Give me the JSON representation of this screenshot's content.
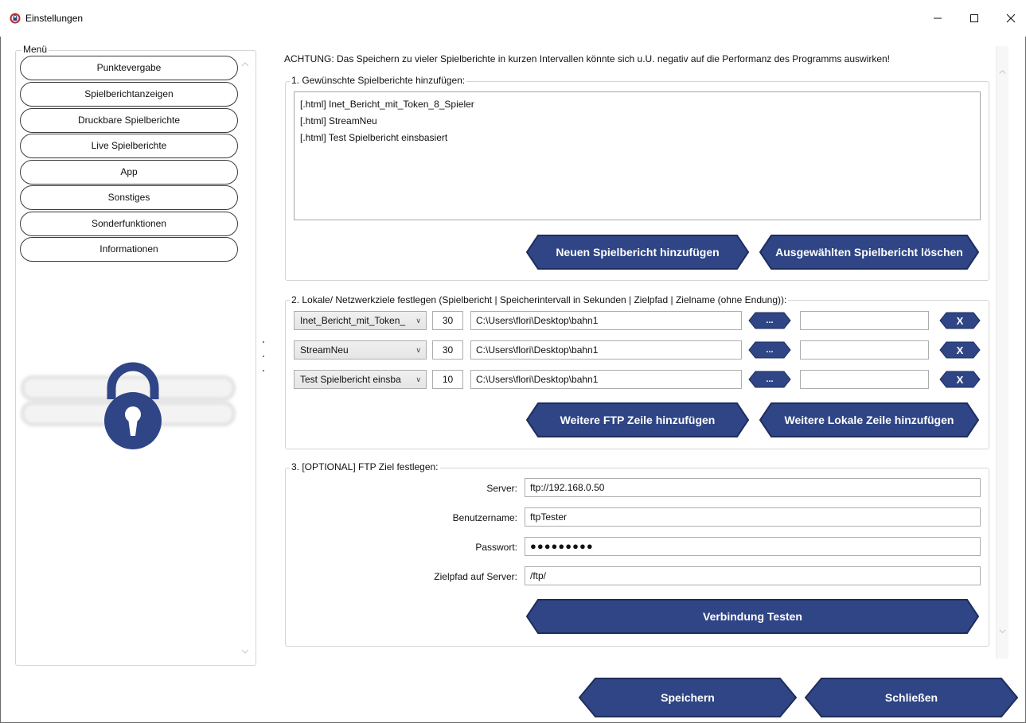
{
  "window": {
    "title": "Einstellungen",
    "app_icon": "lock-shield-icon",
    "controls": {
      "minimize_icon": "minimize-icon",
      "maximize_icon": "maximize-icon",
      "close_icon": "close-icon"
    }
  },
  "menu": {
    "legend": "Menü",
    "items": [
      {
        "label": "Punktevergabe"
      },
      {
        "label": "Spielberichtanzeigen"
      },
      {
        "label": "Druckbare Spielberichte"
      },
      {
        "label": "Live Spielberichte"
      },
      {
        "label": "App"
      },
      {
        "label": "Sonstiges"
      },
      {
        "label": "Sonderfunktionen"
      },
      {
        "label": "Informationen"
      }
    ],
    "locked_icon": "padlock-icon"
  },
  "main": {
    "warning": "ACHTUNG: Das Speichern zu vieler Spielberichte in kurzen Intervallen könnte sich u.U. negativ auf die Performanz des Programms auswirken!",
    "section1": {
      "legend": "1. Gewünschte Spielberichte hinzufügen:",
      "items": [
        "[.html] Inet_Bericht_mit_Token_8_Spieler",
        "[.html] StreamNeu",
        "[.html] Test Spielbericht einsbasiert"
      ],
      "add_button": "Neuen Spielbericht hinzufügen",
      "delete_button": "Ausgewählten Spielbericht löschen"
    },
    "section2": {
      "legend": "2. Lokale/ Netzwerkziele festlegen (Spielbericht | Speicherintervall in Sekunden | Zielpfad | Zielname (ohne Endung)):",
      "rows": [
        {
          "report": "Inet_Bericht_mit_Token_",
          "interval": "30",
          "path": "C:\\Users\\flori\\Desktop\\bahn1",
          "name": ""
        },
        {
          "report": "StreamNeu",
          "interval": "30",
          "path": "C:\\Users\\flori\\Desktop\\bahn1",
          "name": ""
        },
        {
          "report": "Test Spielbericht einsba",
          "interval": "10",
          "path": "C:\\Users\\flori\\Desktop\\bahn1",
          "name": ""
        }
      ],
      "browse_label": "...",
      "remove_label": "X",
      "add_ftp_button": "Weitere FTP Zeile hinzufügen",
      "add_local_button": "Weitere Lokale Zeile hinzufügen"
    },
    "section3": {
      "legend": "3. [OPTIONAL] FTP Ziel festlegen:",
      "server_label": "Server:",
      "server_value": "ftp://192.168.0.50",
      "user_label": "Benutzername:",
      "user_value": "ftpTester",
      "password_label": "Passwort:",
      "password_value": "●●●●●●●●●",
      "path_label": "Zielpfad auf Server:",
      "path_value": "/ftp/",
      "test_button": "Verbindung Testen"
    }
  },
  "footer": {
    "save_button": "Speichern",
    "close_button": "Schließen"
  },
  "colors": {
    "button_fill": "#2f4585",
    "button_border": "#1e2d5c"
  }
}
